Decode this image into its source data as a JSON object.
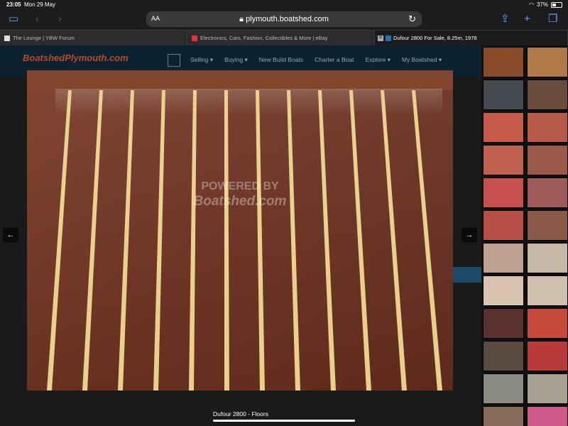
{
  "status": {
    "time": "23:05",
    "date": "Mon 29 May",
    "battery": "37%"
  },
  "browser": {
    "url": "plymouth.boatshed.com",
    "aa_label": "AA",
    "tabs": [
      {
        "title": "The Lounge | YBW Forum",
        "active": false
      },
      {
        "title": "Electronics, Cars, Fashion, Collectibles & More | eBay",
        "active": false
      },
      {
        "title": "Dufour 2800 For Sale, 8.25m, 1978",
        "active": true
      }
    ]
  },
  "site": {
    "logo": "BoatshedPlymouth.com",
    "nav": [
      "Selling ▾",
      "Buying ▾",
      "New Build Boats",
      "Charter a Boat",
      "Explore ▾",
      "My Boatshed ▾"
    ]
  },
  "lightbox": {
    "caption": "Dufour 2800 - Floors",
    "watermark_line1": "POWERED BY",
    "watermark_line2": "Boatshed.com",
    "prev_icon": "←",
    "next_icon": "→"
  },
  "thumbnails": [
    "#8a4a2a",
    "#b07a48",
    "#444a50",
    "#6a4a3a",
    "#c85a4a",
    "#b85a4a",
    "#c06050",
    "#9a5a4a",
    "#c85050",
    "#a05a5a",
    "#b85048",
    "#8a5a48",
    "#c0a090",
    "#c8b8a8",
    "#d8c4b0",
    "#d0c0ae",
    "#5a3030",
    "#c84a3a",
    "#5a4a40",
    "#b83a3a",
    "#8a8a80",
    "#a8a090",
    "#8a6a5a",
    "#d05a8a"
  ]
}
